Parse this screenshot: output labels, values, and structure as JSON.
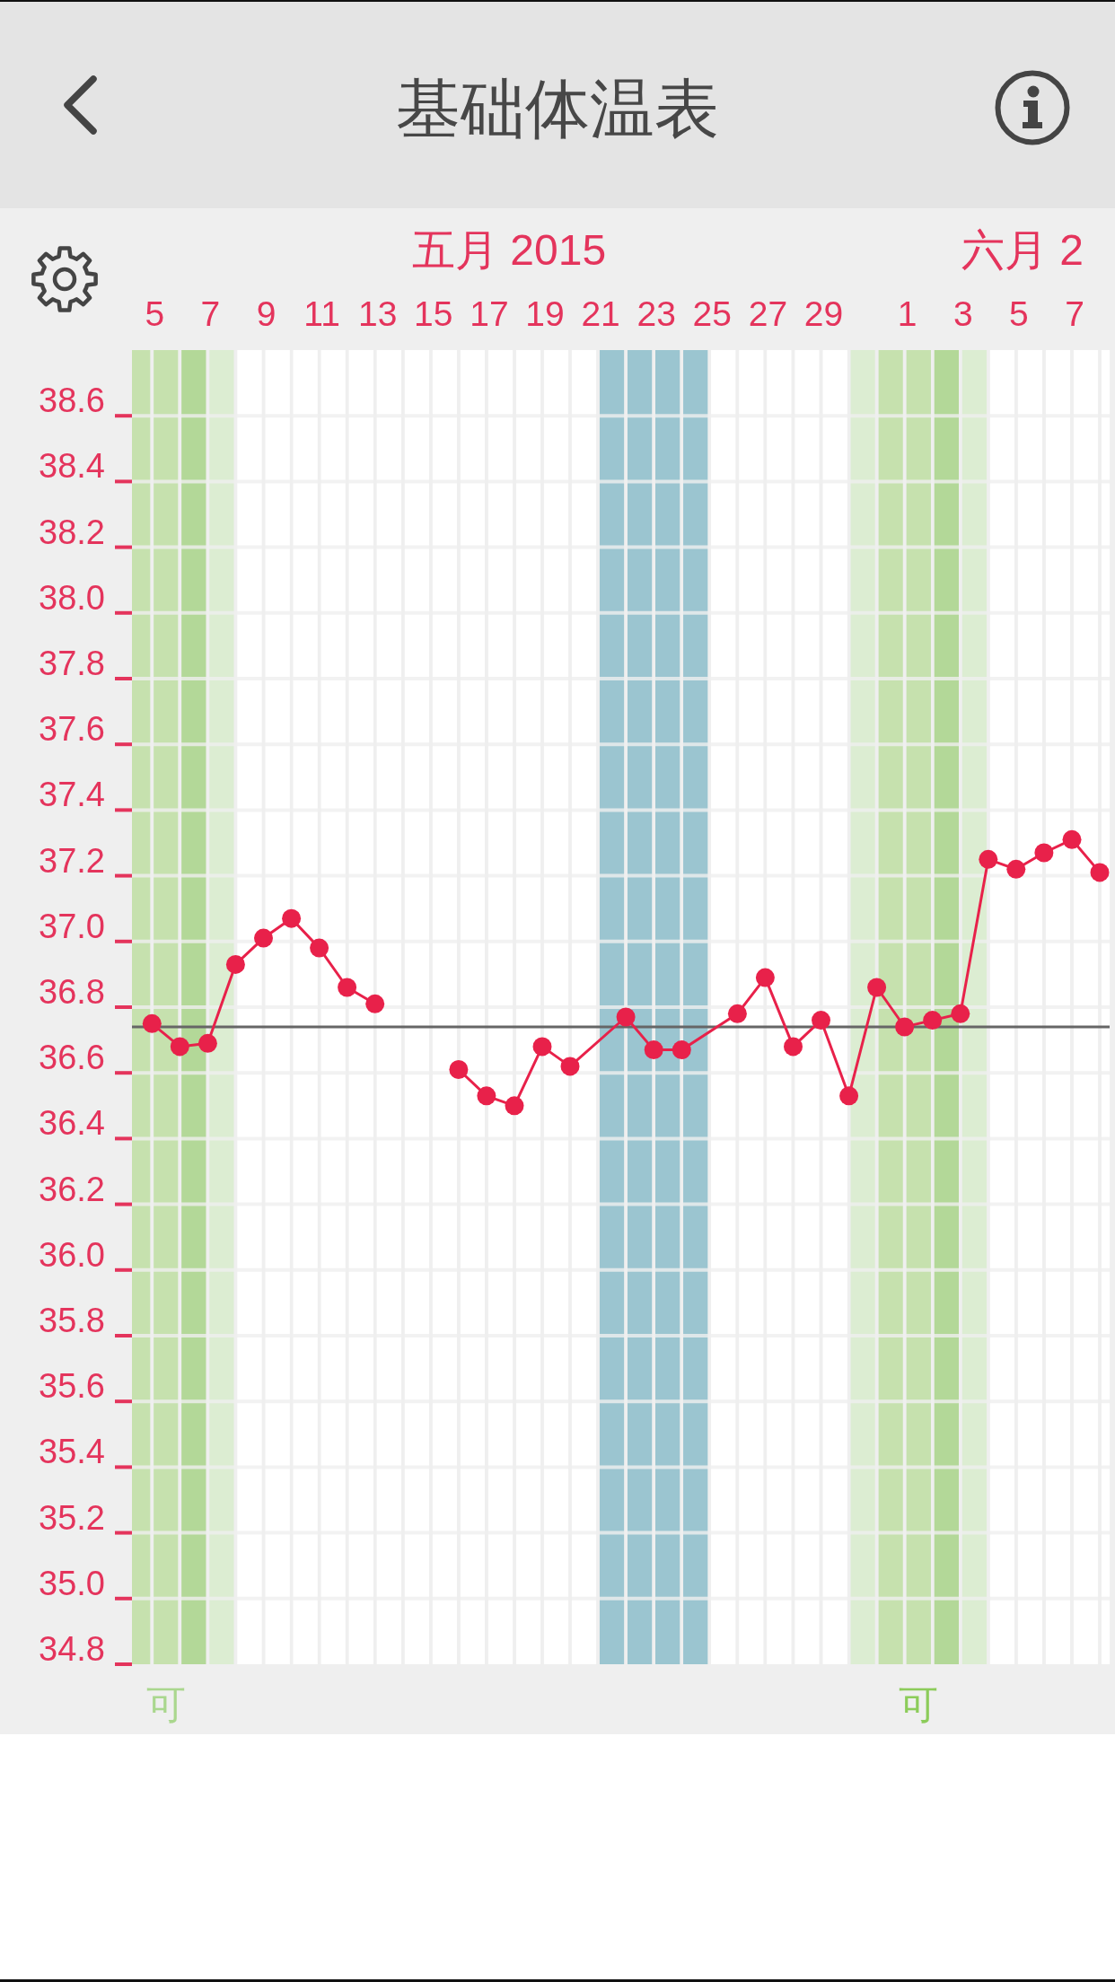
{
  "nav_bar": {
    "title": "基础体温表"
  },
  "chart": {
    "chart_data": {
      "type": "line",
      "categories": [
        null,
        "5",
        null,
        "7",
        null,
        "9",
        null,
        "11",
        null,
        "13",
        null,
        "15",
        null,
        "17",
        null,
        "19",
        null,
        "21",
        null,
        "23",
        null,
        "25",
        null,
        "27",
        null,
        "29",
        null,
        null,
        "1",
        null,
        "3",
        null,
        "5",
        null,
        "7",
        null
      ],
      "values": [
        null,
        36.75,
        36.68,
        36.69,
        36.93,
        37.01,
        37.07,
        36.98,
        36.86,
        36.81,
        null,
        null,
        36.61,
        36.53,
        36.5,
        36.68,
        36.62,
        null,
        36.77,
        36.67,
        36.67,
        null,
        36.78,
        36.89,
        36.68,
        36.76,
        36.53,
        36.86,
        36.74,
        36.76,
        36.78,
        37.25,
        37.22,
        37.27,
        37.31,
        37.21
      ],
      "ylim": [
        34.8,
        38.8
      ],
      "yticks": [
        {
          "value": 38.6,
          "label": "38.6"
        },
        {
          "value": 38.4,
          "label": "38.4"
        },
        {
          "value": 38.2,
          "label": "38.2"
        },
        {
          "value": 38.0,
          "label": "38.0"
        },
        {
          "value": 37.8,
          "label": "37.8"
        },
        {
          "value": 37.6,
          "label": "37.6"
        },
        {
          "value": 37.4,
          "label": "37.4"
        },
        {
          "value": 37.2,
          "label": "37.2"
        },
        {
          "value": 37.0,
          "label": "37.0"
        },
        {
          "value": 36.8,
          "label": "36.8"
        },
        {
          "value": 36.6,
          "label": "36.6"
        },
        {
          "value": 36.4,
          "label": "36.4"
        },
        {
          "value": 36.2,
          "label": "36.2"
        },
        {
          "value": 36.0,
          "label": "36.0"
        },
        {
          "value": 35.8,
          "label": "35.8"
        },
        {
          "value": 35.6,
          "label": "35.6"
        },
        {
          "value": 35.4,
          "label": "35.4"
        },
        {
          "value": 35.2,
          "label": "35.2"
        },
        {
          "value": 35.0,
          "label": "35.0"
        },
        {
          "value": 34.8,
          "label": "34.8"
        }
      ],
      "grid": true,
      "marker": "circle",
      "annotations": [
        "五月 2015",
        "六月 2"
      ],
      "ref_lines": [
        {
          "axis": "y",
          "value": 36.74
        }
      ]
    },
    "day_columns": [
      {
        "shaded": true,
        "color": "#c6e1ae"
      },
      {
        "shaded": true,
        "color": "#c6e1ae",
        "mark": {
          "text": "可",
          "color": "#aad78e"
        }
      },
      {
        "shaded": true,
        "color": "#b3d898"
      },
      {
        "shaded": true,
        "color": "#dcedd2"
      },
      {
        "shaded": false
      },
      {
        "shaded": false
      },
      {
        "shaded": false
      },
      {
        "shaded": false
      },
      {
        "shaded": false
      },
      {
        "shaded": false
      },
      {
        "shaded": false
      },
      {
        "shaded": false
      },
      {
        "shaded": false
      },
      {
        "shaded": false
      },
      {
        "shaded": false
      },
      {
        "shaded": false
      },
      {
        "shaded": false
      },
      {
        "shaded": true,
        "color": "#9bc5d0"
      },
      {
        "shaded": true,
        "color": "#9bc5d0"
      },
      {
        "shaded": true,
        "color": "#9bc5d0"
      },
      {
        "shaded": true,
        "color": "#9bc5d0"
      },
      {
        "shaded": false
      },
      {
        "shaded": false
      },
      {
        "shaded": false
      },
      {
        "shaded": false
      },
      {
        "shaded": false
      },
      {
        "shaded": true,
        "color": "#dcedd2"
      },
      {
        "shaded": true,
        "color": "#c6e1ae"
      },
      {
        "shaded": true,
        "color": "#c6e1ae",
        "mark": {
          "text": "可",
          "color": "#8ccc5a"
        }
      },
      {
        "shaded": true,
        "color": "#b3d898"
      },
      {
        "shaded": true,
        "color": "#dcedd2"
      },
      {
        "shaded": false
      },
      {
        "shaded": false
      },
      {
        "shaded": false
      },
      {
        "shaded": false
      },
      {
        "shaded": false
      }
    ]
  }
}
